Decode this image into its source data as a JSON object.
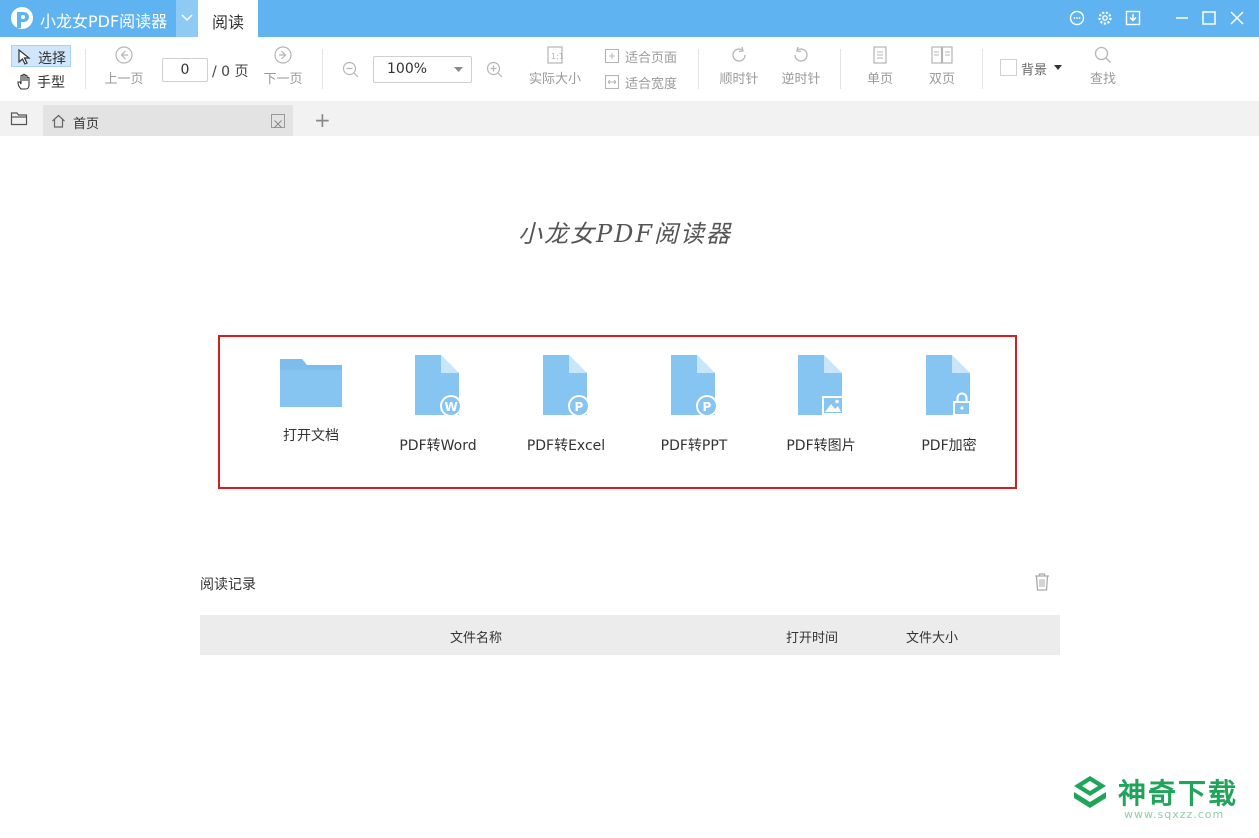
{
  "titlebar": {
    "app_title": "小龙女PDF阅读器",
    "active_tab": "阅读",
    "accent_color": "#5fb3f0",
    "icons": [
      "chat-icon",
      "settings-icon",
      "download-icon",
      "minimize-icon",
      "maximize-icon",
      "close-icon"
    ]
  },
  "toolbar": {
    "mode_select": "选择",
    "mode_hand": "手型",
    "prev_page": "上一页",
    "page_value": "0",
    "page_total": "/ 0 页",
    "next_page": "下一页",
    "zoom_value": "100%",
    "actual_size": "实际大小",
    "fit_page": "适合页面",
    "fit_width": "适合宽度",
    "rotate_cw": "顺时针",
    "rotate_ccw": "逆时针",
    "single_page": "单页",
    "double_page": "双页",
    "background": "背景",
    "search": "查找"
  },
  "tabs": {
    "home": "首页",
    "add": "+"
  },
  "main": {
    "brand": "小龙女PDF阅读器",
    "features": [
      {
        "label": "打开文档",
        "icon": "folder-icon"
      },
      {
        "label": "PDF转Word",
        "icon": "word-file-icon"
      },
      {
        "label": "PDF转Excel",
        "icon": "excel-file-icon"
      },
      {
        "label": "PDF转PPT",
        "icon": "ppt-file-icon"
      },
      {
        "label": "PDF转图片",
        "icon": "image-file-icon"
      },
      {
        "label": "PDF加密",
        "icon": "lock-file-icon"
      }
    ],
    "highlight_color": "#d3201f",
    "history": {
      "title": "阅读记录",
      "columns": [
        "文件名称",
        "打开时间",
        "文件大小"
      ]
    }
  },
  "watermark": {
    "name": "神奇下载",
    "url": "www.sqxzz.com",
    "color": "#1fa55a"
  }
}
